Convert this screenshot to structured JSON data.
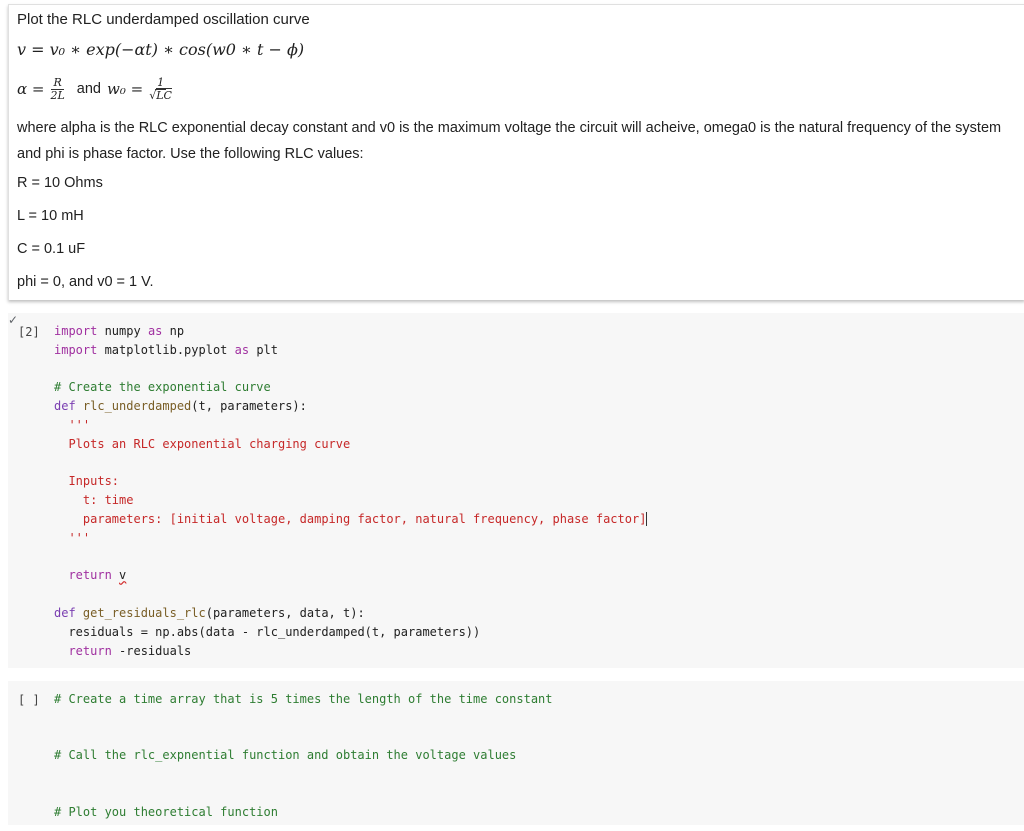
{
  "text_cell": {
    "title": "Plot the RLC underdamped oscillation curve",
    "equation": "v = v₀ ∗ exp(−αt) ∗ cos(w0 ∗ t − ϕ)",
    "alpha_lhs": "α =",
    "alpha_num": "R",
    "alpha_den": "2L",
    "and_word": "and",
    "w0_lhs": "w₀ =",
    "w0_num": "1",
    "w0_den_sqrt": "√",
    "w0_den": "LC",
    "description": "where alpha is the RLC exponential decay constant and v0 is the maximum voltage the circuit will acheive, omega0 is the natural frequency of the system and phi is phase factor. Use the following RLC values:",
    "values": [
      "R = 10 Ohms",
      "L = 10 mH",
      "C = 0.1 uF",
      "phi = 0, and v0 = 1 V."
    ]
  },
  "code_cell_1": {
    "run_mark": "✓",
    "prompt": "[2]",
    "lines": {
      "l1_kw": "import",
      "l1_rest": " numpy ",
      "l1_as": "as",
      "l1_alias": " np",
      "l2_kw": "import",
      "l2_rest": " matplotlib.pyplot ",
      "l2_as": "as",
      "l2_alias": " plt",
      "l3_comment": "# Create the exponential curve",
      "l4_def": "def",
      "l4_name": " rlc_underdamped",
      "l4_args": "(t, parameters):",
      "l5_doc_open": "'''",
      "l6_doc": "Plots an RLC exponential charging curve",
      "l7_doc": "Inputs:",
      "l8_doc": "  t: time",
      "l9_doc": "  parameters: [initial voltage, damping factor, natural frequency, phase factor]",
      "l10_doc_close": "'''",
      "l11_ret": "return",
      "l11_var": "v",
      "l12_def": "def",
      "l12_name": " get_residuals_rlc",
      "l12_args": "(parameters, data, t):",
      "l13": "residuals = np.abs(data - rlc_underdamped(t, parameters))",
      "l14_ret": "return",
      "l14_rest": " -residuals"
    }
  },
  "code_cell_2": {
    "prompt": "[ ]",
    "comment1": "# Create a time array that is 5 times the length of the time constant",
    "comment2": "# Call the rlc_expnential function and obtain the voltage values",
    "comment3": "# Plot you theoretical function"
  }
}
